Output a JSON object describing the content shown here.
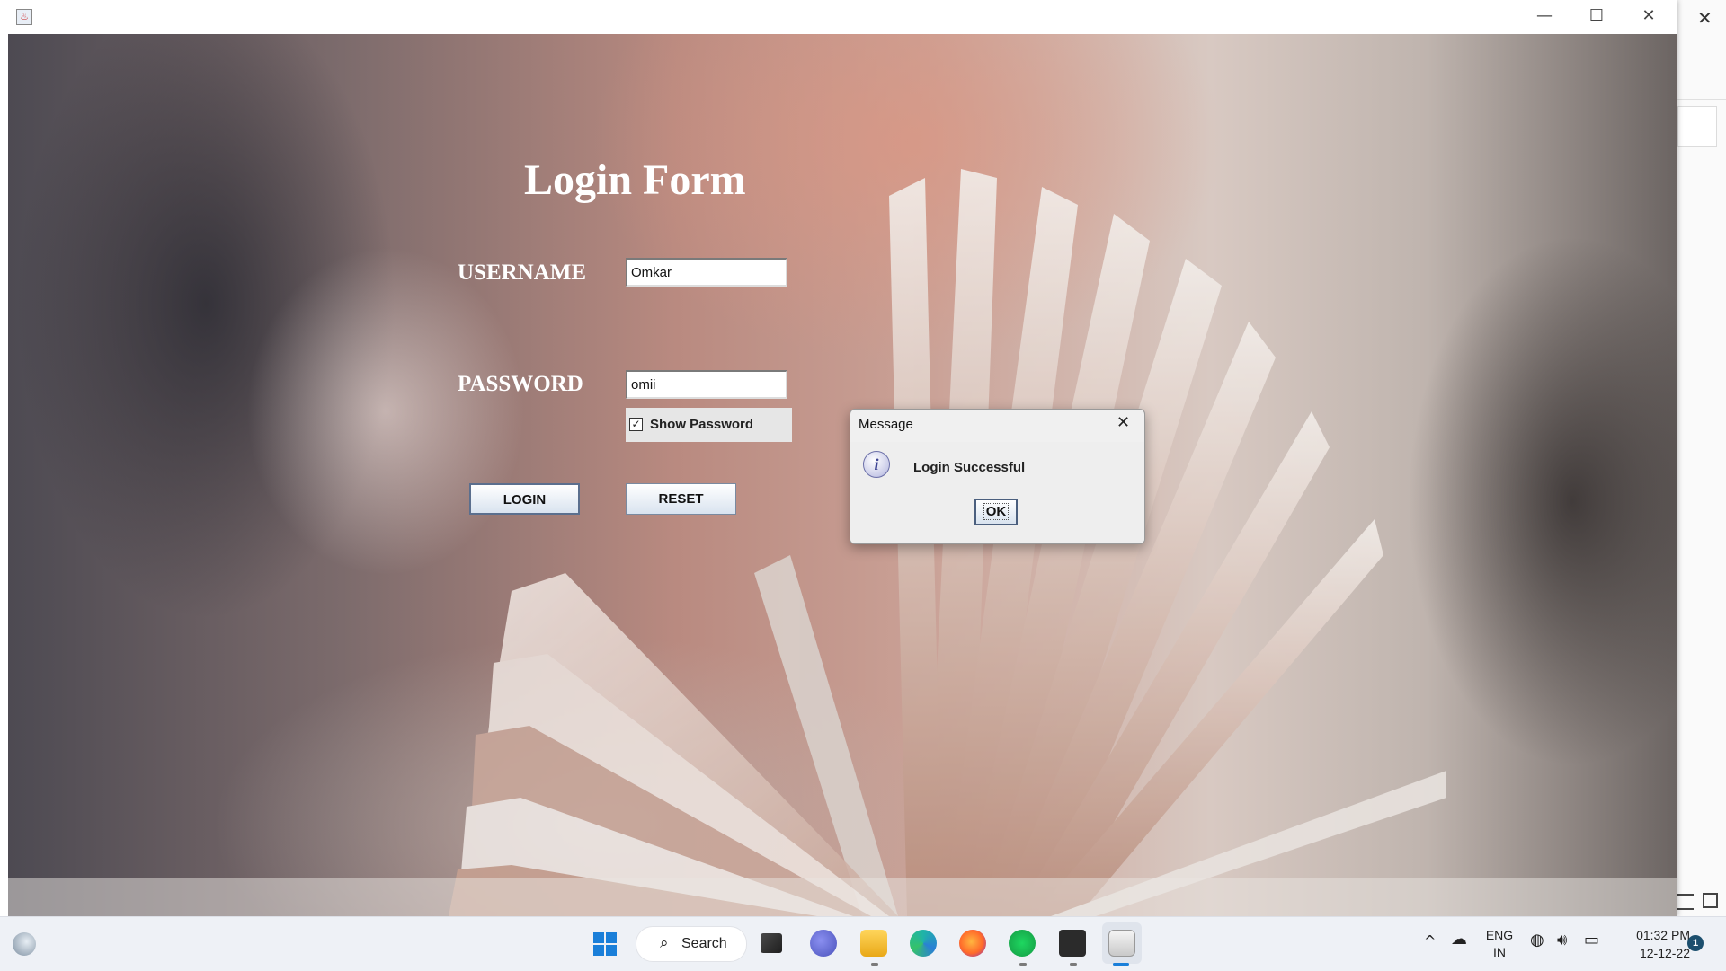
{
  "window": {
    "minimize_glyph": "—",
    "maximize_glyph": "☐",
    "close_glyph": "✕"
  },
  "form": {
    "title": "Login Form",
    "username_label": "USERNAME",
    "username_value": "Omkar",
    "password_label": "PASSWORD",
    "password_value": "omii",
    "show_password_label": "Show Password",
    "show_password_checked": true,
    "login_label": "LOGIN",
    "reset_label": "RESET"
  },
  "dialog": {
    "title": "Message",
    "message": "Login Successful",
    "ok_label": "OK",
    "icon": "info-icon"
  },
  "taskbar": {
    "search_label": "Search",
    "apps": [
      "task-view-icon",
      "chat-icon",
      "file-explorer-icon",
      "edge-icon",
      "firefox-icon",
      "spotify-icon",
      "terminal-icon",
      "java-icon"
    ],
    "lang_line1": "ENG",
    "lang_line2": "IN",
    "time": "01:32 PM",
    "date": "12-12-22",
    "notification_count": "1"
  },
  "colors": {
    "accent": "#1a7fd9",
    "dialog_info": "#3d4393"
  }
}
